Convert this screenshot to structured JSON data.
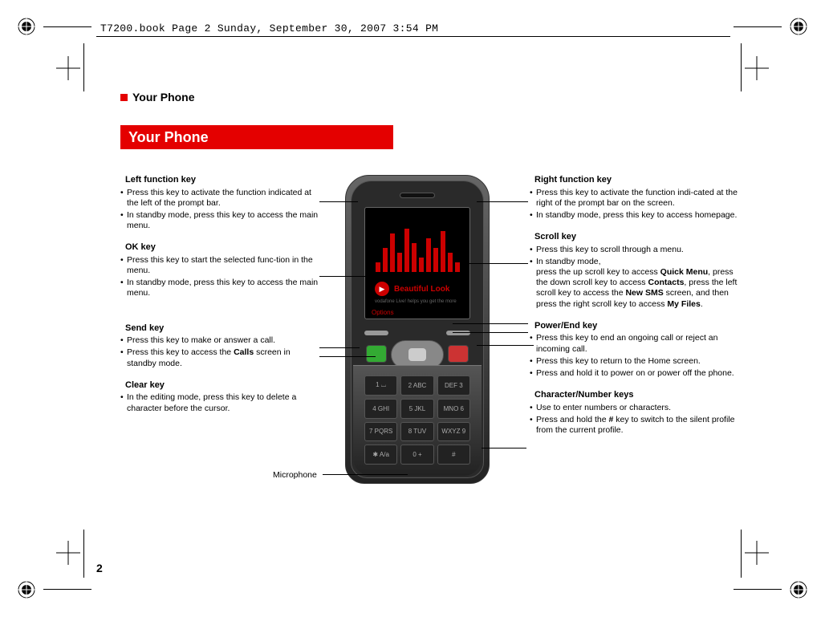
{
  "header_text": "T7200.book  Page 2  Sunday, September 30, 2007  3:54 PM",
  "section_label": "Your Phone",
  "title": "Your Phone",
  "page_number": "2",
  "mic_label": "Microphone",
  "phone_screen": {
    "title": "Beautiful Look",
    "subtitle": "vodafone Live! helps you get the more",
    "left_soft": "Options",
    "right_soft": ""
  },
  "left": {
    "left_fn": {
      "h": "Left function key",
      "b1": "Press this key to activate the function indicated at the left of the prompt bar.",
      "b2": "In standby mode, press this key to access the main menu."
    },
    "ok": {
      "h": "OK key",
      "b1": "Press this key to start the selected func-tion in the menu.",
      "b2": "In standby mode, press this key to access the main menu."
    },
    "send": {
      "h": "Send key",
      "b1": "Press this key to make or answer a call.",
      "b2a": "Press this key to access the ",
      "b2bold": "Calls",
      "b2b": " screen in standby mode."
    },
    "clear": {
      "h": "Clear key",
      "b1": "In the editing mode, press this key to delete a character before the cursor."
    }
  },
  "right": {
    "right_fn": {
      "h": "Right function key",
      "b1": "Press this key to activate the function indi-cated at the right of the prompt bar on the screen.",
      "b2": "In standby mode, press this key to access homepage."
    },
    "scroll": {
      "h": "Scroll key",
      "b1": "Press this key to scroll through a menu.",
      "b2a": "In standby mode,",
      "b2line": "press the up scroll key to access ",
      "b2bold1": "Quick Menu",
      "b2mid1": ", press the down scroll key to access ",
      "b2bold2": "Contacts",
      "b2mid2": ", press the left scroll key to access the ",
      "b2bold3": "New SMS",
      "b2mid3": " screen,  and then press the right scroll key to access ",
      "b2bold4": "My Files",
      "b2end": "."
    },
    "power": {
      "h": "Power/End key",
      "b1": "Press this key to end an ongoing call or reject an incoming call.",
      "b2": "Press this key to return to the Home screen.",
      "b3": "Press and hold it to power on or power off the phone."
    },
    "char": {
      "h": "Character/Number keys",
      "b1": "Use to enter numbers or characters.",
      "b2a": "Press and hold the ",
      "b2bold": "#",
      "b2b": " key to switch to the silent profile from the current profile."
    }
  },
  "keys": [
    "1 ⌴",
    "2 ABC",
    "DEF 3",
    "4 GHI",
    "5 JKL",
    "MNO 6",
    "7 PQRS",
    "8 TUV",
    "WXYZ 9",
    "✱ A/a",
    "0 +",
    "#"
  ]
}
